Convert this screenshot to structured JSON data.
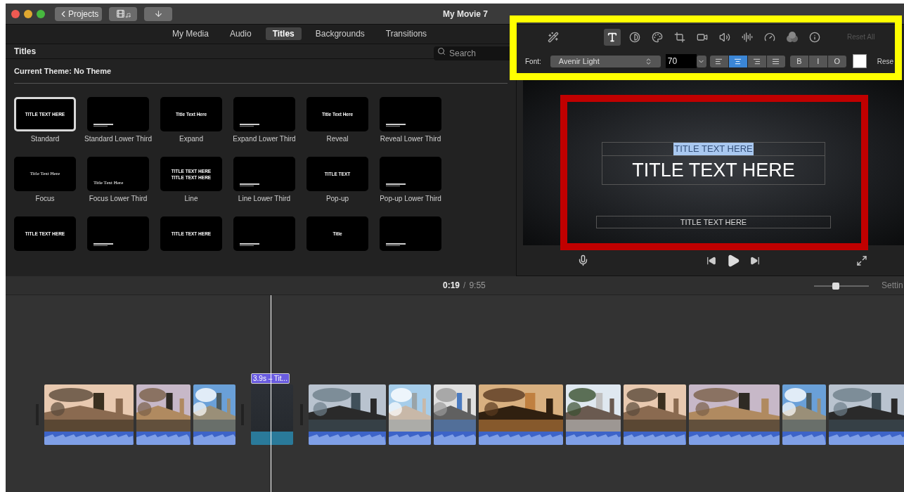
{
  "window": {
    "title": "My Movie 7",
    "back_button": "Projects"
  },
  "browser": {
    "tabs": [
      {
        "label": "My Media",
        "selected": false
      },
      {
        "label": "Audio",
        "selected": false
      },
      {
        "label": "Titles",
        "selected": true
      },
      {
        "label": "Backgrounds",
        "selected": false
      },
      {
        "label": "Transitions",
        "selected": false
      }
    ],
    "header": "Titles",
    "search": {
      "placeholder": "Search"
    },
    "theme": "Current Theme: No Theme",
    "titles": [
      {
        "label": "Standard",
        "selected": true,
        "kind": "center",
        "preview": [
          "TITLE TEXT HERE"
        ]
      },
      {
        "label": "Standard Lower Third",
        "selected": false,
        "kind": "lower"
      },
      {
        "label": "Expand",
        "selected": false,
        "kind": "center",
        "preview": [
          "Title Text Here"
        ]
      },
      {
        "label": "Expand Lower Third",
        "selected": false,
        "kind": "lower"
      },
      {
        "label": "Reveal",
        "selected": false,
        "kind": "center",
        "preview": [
          "Title Text Here"
        ]
      },
      {
        "label": "Reveal Lower Third",
        "selected": false,
        "kind": "lower"
      },
      {
        "label": "Focus",
        "selected": false,
        "kind": "serif",
        "preview": [
          "Title Text Here"
        ]
      },
      {
        "label": "Focus Lower Third",
        "selected": false,
        "kind": "serif-lower",
        "preview": [
          "Title Text Here"
        ]
      },
      {
        "label": "Line",
        "selected": false,
        "kind": "center",
        "preview": [
          "TITLE TEXT HERE",
          "TITLE TEXT HERE"
        ]
      },
      {
        "label": "Line Lower Third",
        "selected": false,
        "kind": "lower"
      },
      {
        "label": "Pop-up",
        "selected": false,
        "kind": "center",
        "preview": [
          "TITLE TEXT"
        ]
      },
      {
        "label": "Pop-up Lower Third",
        "selected": false,
        "kind": "lower"
      },
      {
        "selected": false,
        "kind": "center",
        "preview": [
          "TITLE TEXT HERE"
        ]
      },
      {
        "selected": false,
        "kind": "lower"
      },
      {
        "selected": false,
        "kind": "center",
        "preview": [
          "TITLE TEXT HERE"
        ]
      },
      {
        "selected": false,
        "kind": "lower"
      },
      {
        "selected": false,
        "kind": "center",
        "preview": [
          "Title"
        ]
      },
      {
        "selected": false,
        "kind": "lower"
      }
    ]
  },
  "inspector": {
    "tools": [
      {
        "kind": "wand",
        "selected": false
      },
      {
        "kind": "text",
        "selected": true
      },
      {
        "kind": "color-balance",
        "selected": false
      },
      {
        "kind": "palette",
        "selected": false
      },
      {
        "kind": "crop",
        "selected": false
      },
      {
        "kind": "camera",
        "selected": false
      },
      {
        "kind": "volume",
        "selected": false
      },
      {
        "kind": "equalizer",
        "selected": false
      },
      {
        "kind": "speed",
        "selected": false
      },
      {
        "kind": "filters",
        "selected": false
      },
      {
        "kind": "info",
        "selected": false
      }
    ],
    "reset_all": {
      "label": "Reset All",
      "disabled": true
    },
    "font_label": "Font:",
    "font": "Avenir Light",
    "size": "70",
    "alignments": [
      {
        "kind": "left",
        "selected": false
      },
      {
        "kind": "center",
        "selected": true
      },
      {
        "kind": "right",
        "selected": false
      },
      {
        "kind": "justify",
        "selected": false
      }
    ],
    "styles": [
      "B",
      "I",
      "O"
    ],
    "reset": "Rese"
  },
  "viewer": {
    "lines": [
      {
        "text": "TITLE TEXT HERE",
        "kind": "small",
        "selected": true
      },
      {
        "text": "TITLE TEXT HERE",
        "kind": "large",
        "selected": false
      },
      {
        "text": "TITLE TEXT HERE",
        "kind": "lower",
        "selected": false
      }
    ]
  },
  "timeline": {
    "current": "0:19",
    "separator": "/",
    "total": "9:55",
    "zoom": {
      "level": 0.4
    },
    "settings": "Settin",
    "title_clip": "3.9s – Tit..."
  },
  "annotations": [
    {
      "kind": "frame",
      "color": "#ffff00"
    },
    {
      "kind": "frame",
      "color": "#c00000"
    }
  ]
}
